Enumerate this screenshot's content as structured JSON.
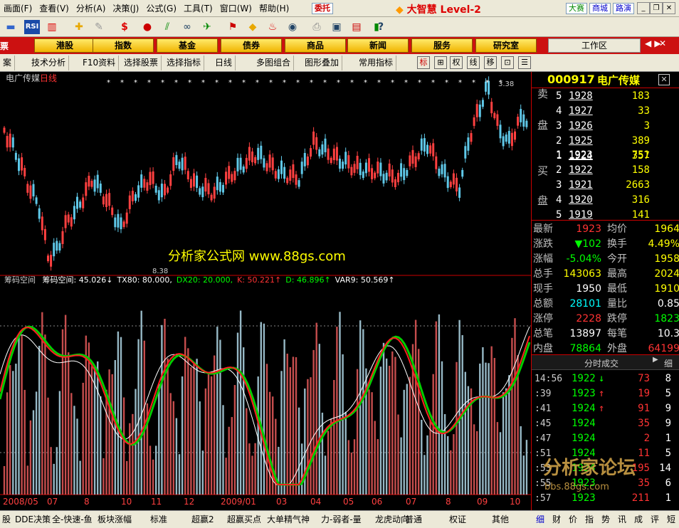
{
  "menu": [
    "画面(F)",
    "查看(V)",
    "分析(A)",
    "决策(J)",
    "公式(G)",
    "工具(T)",
    "窗口(W)",
    "帮助(H)"
  ],
  "entrust": "委托",
  "brand": "大智慧 Level-2",
  "top_tabs": [
    "大赛",
    "商城",
    "路演"
  ],
  "nav": [
    "港股",
    "指数",
    "基金",
    "债券",
    "商品",
    "新闻",
    "服务",
    "研究室"
  ],
  "workarea": "工作区",
  "tabs": [
    "技术分析",
    "F10资料",
    "选择股票",
    "选择指标",
    "日线",
    "多图组合",
    "图形叠加",
    "常用指标"
  ],
  "tab_prefix": "案",
  "tab_icons": [
    "标",
    "⊞",
    "权",
    "线",
    "移",
    "⊡",
    "☰"
  ],
  "stock": {
    "code": "000917",
    "name": "电广传媒"
  },
  "chart": {
    "title": "电广传媒",
    "period": "日线",
    "high_label": "3.38",
    "low_label": "8.38",
    "watermark": "分析家公式网 www.88gs.com",
    "indicator_name": "筹码空间",
    "indicator_values": [
      {
        "label": "筹码空间:",
        "value": "45.026↓",
        "color": "#ffffff"
      },
      {
        "label": "TX80:",
        "value": "80.000,",
        "color": "#ffffff"
      },
      {
        "label": "DX20:",
        "value": "20.000,",
        "color": "#00ff00"
      },
      {
        "label": "K:",
        "value": "50.221↑",
        "color": "#ff3333"
      },
      {
        "label": "D:",
        "value": "46.896↑",
        "color": "#00ff00"
      },
      {
        "label": "VAR9:",
        "value": "50.569↑",
        "color": "#ffffff"
      }
    ],
    "x_labels": [
      "2008/05",
      "07",
      "8",
      "10",
      "11",
      "12",
      "2009/01",
      "03",
      "04",
      "05",
      "06",
      "07",
      "8",
      "09",
      "10"
    ]
  },
  "orderbook": {
    "sell_label": [
      "卖",
      "盘"
    ],
    "buy_label": [
      "买",
      "盘"
    ],
    "sell": [
      {
        "n": "5",
        "p": "1928",
        "v": "183"
      },
      {
        "n": "4",
        "p": "1927",
        "v": "33"
      },
      {
        "n": "3",
        "p": "1926",
        "v": "3"
      },
      {
        "n": "2",
        "p": "1925",
        "v": "389"
      },
      {
        "n": "1",
        "p": "1924",
        "v": "357"
      }
    ],
    "buy": [
      {
        "n": "1",
        "p": "1923",
        "v": "751"
      },
      {
        "n": "2",
        "p": "1922",
        "v": "158"
      },
      {
        "n": "3",
        "p": "1921",
        "v": "2663"
      },
      {
        "n": "4",
        "p": "1920",
        "v": "316"
      },
      {
        "n": "5",
        "p": "1919",
        "v": "141"
      }
    ]
  },
  "stats": [
    {
      "k": "最新",
      "v": "1923",
      "vc": "#ff3333",
      "k2": "均价",
      "v2": "1964",
      "v2c": "#ffff00"
    },
    {
      "k": "涨跌",
      "v": "▼102",
      "vc": "#00ff00",
      "k2": "换手",
      "v2": "4.49%",
      "v2c": "#ffff00"
    },
    {
      "k": "涨幅",
      "v": "-5.04%",
      "vc": "#00ff00",
      "k2": "今开",
      "v2": "1958",
      "v2c": "#ffff00"
    },
    {
      "k": "总手",
      "v": "143063",
      "vc": "#ffff00",
      "k2": "最高",
      "v2": "2024",
      "v2c": "#ffff00"
    },
    {
      "k": "现手",
      "v": "1950",
      "vc": "#ffffff",
      "k2": "最低",
      "v2": "1910",
      "v2c": "#ffff00"
    },
    {
      "k": "总额",
      "v": "28101",
      "vc": "#00ffff",
      "k2": "量比",
      "v2": "0.85",
      "v2c": "#ffffff"
    },
    {
      "k": "涨停",
      "v": "2228",
      "vc": "#ff3333",
      "k2": "跌停",
      "v2": "1823",
      "v2c": "#00ff00"
    },
    {
      "k": "总笔",
      "v": "13897",
      "vc": "#ffffff",
      "k2": "每笔",
      "v2": "10.3",
      "v2c": "#ffffff"
    },
    {
      "k": "内盘",
      "v": "78864",
      "vc": "#00ff00",
      "k2": "外盘",
      "v2": "64199",
      "v2c": "#ff3333"
    }
  ],
  "trades_header": "分时成交",
  "trades_tab": "细",
  "trades": [
    {
      "t": "14:56",
      "p": "1922",
      "a": "↓",
      "ac": "#00ff00",
      "v": "73",
      "vc": "#ff3333",
      "c": "8"
    },
    {
      "t": ":39",
      "p": "1923",
      "a": "↑",
      "ac": "#ff3333",
      "v": "19",
      "vc": "#ff3333",
      "c": "5"
    },
    {
      "t": ":41",
      "p": "1924",
      "a": "↑",
      "ac": "#ff3333",
      "v": "91",
      "vc": "#ff3333",
      "c": "9"
    },
    {
      "t": ":45",
      "p": "1924",
      "a": "",
      "ac": "#ffffff",
      "v": "35",
      "vc": "#ff3333",
      "c": "9"
    },
    {
      "t": ":47",
      "p": "1924",
      "a": "",
      "ac": "#ffffff",
      "v": "2",
      "vc": "#ff3333",
      "c": "1"
    },
    {
      "t": ":51",
      "p": "1924",
      "a": "",
      "ac": "#ffffff",
      "v": "11",
      "vc": "#ff3333",
      "c": "5"
    },
    {
      "t": ":53",
      "p": "1924",
      "a": "",
      "ac": "#ffffff",
      "v": "195",
      "vc": "#ff3333",
      "c": "14"
    },
    {
      "t": ":55",
      "p": "1923",
      "a": "",
      "ac": "#ffffff",
      "v": "35",
      "vc": "#ff3333",
      "c": "6"
    },
    {
      "t": ":57",
      "p": "1923",
      "a": "",
      "ac": "#ffffff",
      "v": "211",
      "vc": "#ff3333",
      "c": "1"
    }
  ],
  "forum_watermark": "分析家论坛",
  "forum_url": "bbs.88gs.com",
  "bottom_tabs": [
    "股",
    "DDE决策",
    "全-快速-鱼",
    "板块涨幅",
    "标准",
    "超赢2",
    "超赢买点",
    "大单精气神",
    "力-弱者-量",
    "龙虎动向",
    "普通",
    "权证",
    "其他"
  ],
  "bottom_right": [
    "细",
    "财",
    "价",
    "指",
    "势",
    "讯",
    "成",
    "评",
    "短"
  ]
}
